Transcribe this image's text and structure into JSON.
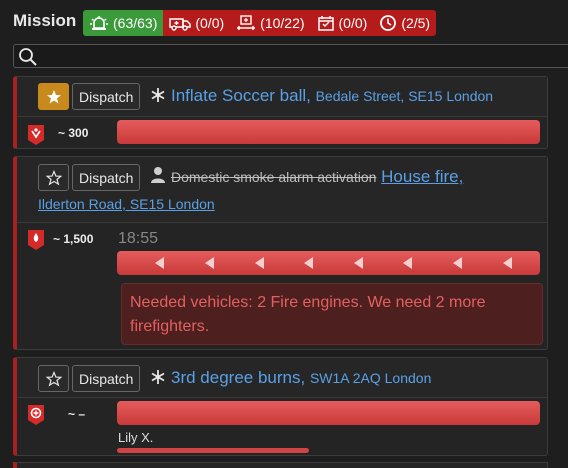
{
  "header": {
    "title": "Mission",
    "badges": [
      {
        "icon": "siren-icon",
        "label": "(63/63)",
        "color": "#3b9b3b"
      },
      {
        "icon": "ambulance-icon",
        "label": "(0/0)",
        "color": "#b51b1b"
      },
      {
        "icon": "patient-icon",
        "label": "(10/22)",
        "color": "#b51b1b"
      },
      {
        "icon": "calendar-icon",
        "label": "(0/0)",
        "color": "#b51b1b"
      },
      {
        "icon": "clock-icon",
        "label": "(2/5)",
        "color": "#b51b1b"
      }
    ]
  },
  "search": {
    "placeholder": "",
    "value": ""
  },
  "missions": [
    {
      "starred": true,
      "dispatch_label": "Dispatch",
      "type_icon": "snowflake-icon",
      "title": "Inflate Soccer ball,",
      "address": "Bedale Street, SE15 London",
      "count": "~ 300",
      "progress": 1.0
    },
    {
      "starred": false,
      "dispatch_label": "Dispatch",
      "type_icon": "person-icon",
      "struck_title": "Domestic smoke alarm activation",
      "title": "House fire,",
      "address": "Ilderton Road, SE15 London",
      "count": "~ 1,500",
      "time": "18:55",
      "progress": 1.0,
      "needed": "Needed vehicles: 2 Fire engines. We need 2 more firefighters."
    },
    {
      "starred": false,
      "dispatch_label": "Dispatch",
      "type_icon": "snowflake-icon",
      "title": "3rd degree burns,",
      "address": "SW1A 2AQ London",
      "count": "~ –",
      "progress": 1.0,
      "patient_name": "Lily X.",
      "patient_progress": 0.46
    }
  ]
}
